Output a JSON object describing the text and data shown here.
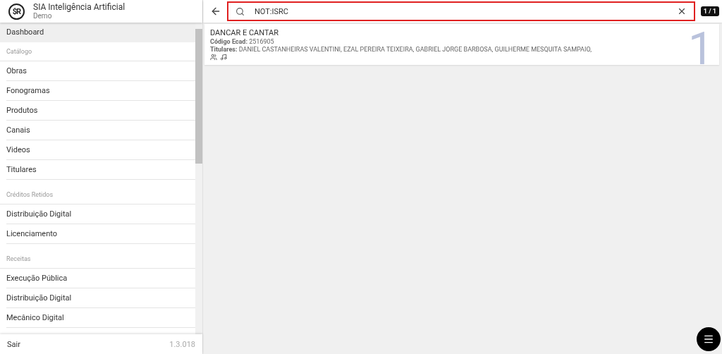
{
  "app": {
    "title": "SIA Inteligência Artificial",
    "subtitle": "Demo",
    "logo": "$R"
  },
  "sidebar": {
    "sections": [
      {
        "items": [
          {
            "label": "Dashboard",
            "selected": true
          }
        ]
      },
      {
        "heading": "Catálogo",
        "items": [
          {
            "label": "Obras",
            "selected": false
          },
          {
            "label": "Fonogramas",
            "selected": false
          },
          {
            "label": "Produtos",
            "selected": false
          },
          {
            "label": "Canais",
            "selected": false
          },
          {
            "label": "Videos",
            "selected": false
          },
          {
            "label": "Titulares",
            "selected": false
          }
        ]
      },
      {
        "heading": "Créditos Retidos",
        "items": [
          {
            "label": "Distribuição Digital",
            "selected": false
          },
          {
            "label": "Licenciamento",
            "selected": false
          }
        ]
      },
      {
        "heading": "Receitas",
        "items": [
          {
            "label": "Execução Pública",
            "selected": false
          },
          {
            "label": "Distribuição Digital",
            "selected": false
          },
          {
            "label": "Mecânico Digital",
            "selected": false
          }
        ]
      }
    ],
    "footer": {
      "action": "Sair",
      "version": "1.3.018"
    }
  },
  "search": {
    "value": "NOT:ISRC",
    "counter": "1 / 1"
  },
  "results": [
    {
      "title": "DANCAR E CANTAR",
      "index": "1",
      "fields": [
        {
          "label": "Código Ecad:",
          "value": "2516905"
        },
        {
          "label": "Titulares:",
          "value": "DANIEL CASTANHEIRAS VALENTINI, EZAL PEREIRA TEIXEIRA, GABRIEL JORGE BARBOSA, GUILHERME MESQUITA SAMPAIO,"
        }
      ]
    }
  ]
}
